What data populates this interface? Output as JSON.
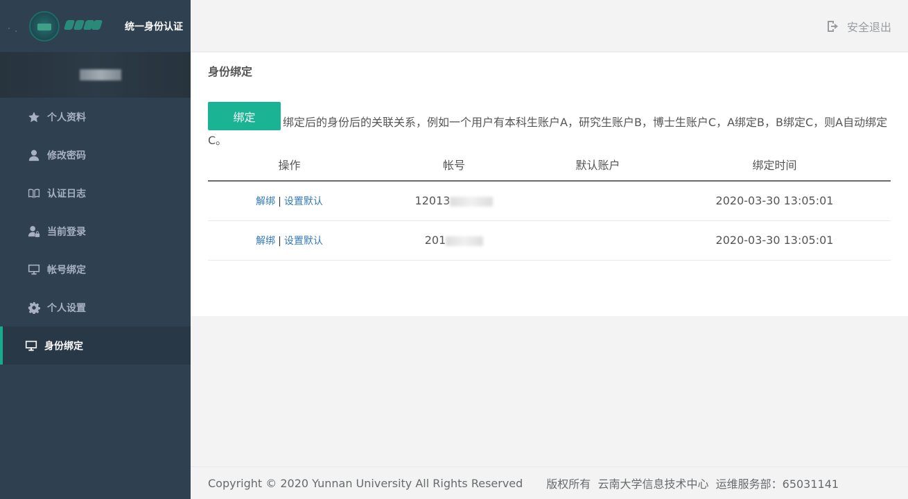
{
  "app": {
    "title": "统一身份认证"
  },
  "topbar": {
    "logout_label": "安全退出"
  },
  "nav": {
    "items": [
      {
        "label": "个人资料",
        "icon": "star-icon"
      },
      {
        "label": "修改密码",
        "icon": "user-icon"
      },
      {
        "label": "认证日志",
        "icon": "book-icon"
      },
      {
        "label": "当前登录",
        "icon": "user-lock-icon"
      },
      {
        "label": "帐号绑定",
        "icon": "monitor-icon"
      },
      {
        "label": "个人设置",
        "icon": "gear-icon"
      },
      {
        "label": "身份绑定",
        "icon": "monitor-icon",
        "active": true
      }
    ]
  },
  "panel": {
    "title": "身份绑定",
    "bind_button": "绑定",
    "description": "绑定后的身份后的关联关系，例如一个用户有本科生账户A，研究生账户B，博士生账户C，A绑定B，B绑定C，则A自动绑定C。"
  },
  "table": {
    "headers": [
      "操作",
      "帐号",
      "默认账户",
      "绑定时间"
    ],
    "rows": [
      {
        "unbind": "解绑",
        "sep": "|",
        "set_default": "设置默认",
        "account": "12013",
        "default": "",
        "time": "2020-03-30 13:05:01"
      },
      {
        "unbind": "解绑",
        "sep": "|",
        "set_default": "设置默认",
        "account": "201",
        "default": "",
        "time": "2020-03-30 13:05:01"
      }
    ]
  },
  "footer": {
    "copyright": "Copyright © 2020 Yunnan University All Rights Reserved",
    "owner": "版权所有  云南大学信息技术中心  运维服务部：65031141"
  },
  "colors": {
    "sidebar_bg": "#2f4050",
    "accent": "#1ab394",
    "link": "#337ab7"
  }
}
